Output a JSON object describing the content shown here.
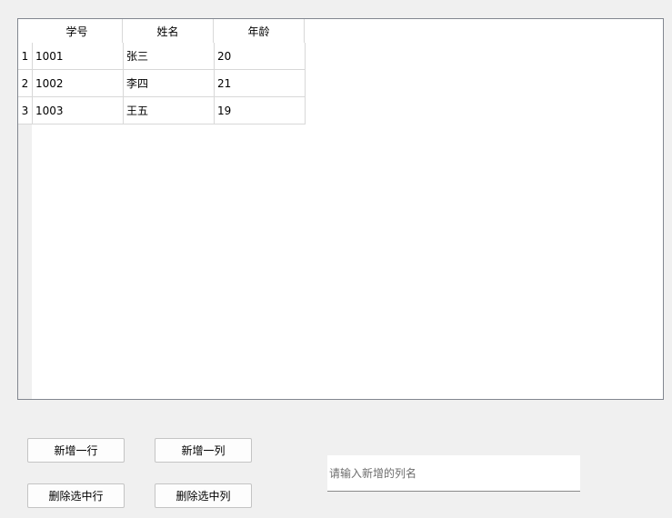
{
  "table": {
    "headers": [
      "学号",
      "姓名",
      "年龄"
    ],
    "row_numbers": [
      "1",
      "2",
      "3"
    ],
    "rows": [
      [
        "1001",
        "张三",
        "20"
      ],
      [
        "1002",
        "李四",
        "21"
      ],
      [
        "1003",
        "王五",
        "19"
      ]
    ]
  },
  "buttons": {
    "add_row": "新增一行",
    "add_column": "新增一列",
    "delete_row": "删除选中行",
    "delete_column": "删除选中列"
  },
  "column_input": {
    "placeholder": "请输入新增的列名",
    "value": ""
  }
}
